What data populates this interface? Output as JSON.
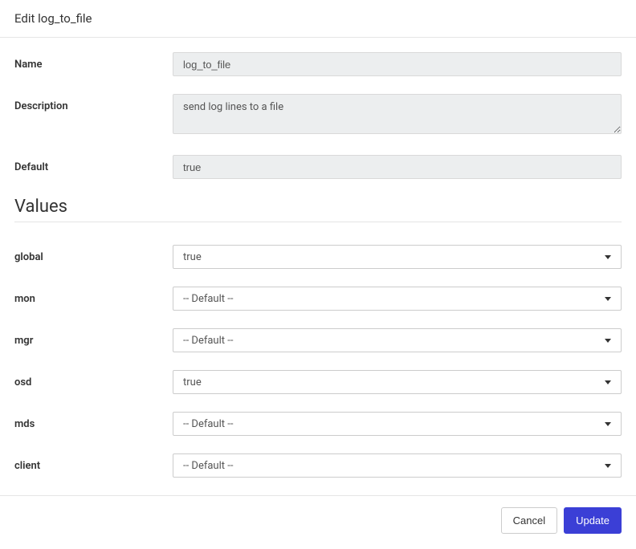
{
  "header": {
    "title": "Edit log_to_file"
  },
  "fields": {
    "name": {
      "label": "Name",
      "value": "log_to_file"
    },
    "description": {
      "label": "Description",
      "value": "send log lines to a file"
    },
    "default": {
      "label": "Default",
      "value": "true"
    }
  },
  "values_section": {
    "heading": "Values",
    "items": [
      {
        "key": "global",
        "label": "global",
        "value": "true"
      },
      {
        "key": "mon",
        "label": "mon",
        "value": "-- Default --"
      },
      {
        "key": "mgr",
        "label": "mgr",
        "value": "-- Default --"
      },
      {
        "key": "osd",
        "label": "osd",
        "value": "true"
      },
      {
        "key": "mds",
        "label": "mds",
        "value": "-- Default --"
      },
      {
        "key": "client",
        "label": "client",
        "value": "-- Default --"
      }
    ]
  },
  "footer": {
    "cancel": "Cancel",
    "update": "Update"
  }
}
